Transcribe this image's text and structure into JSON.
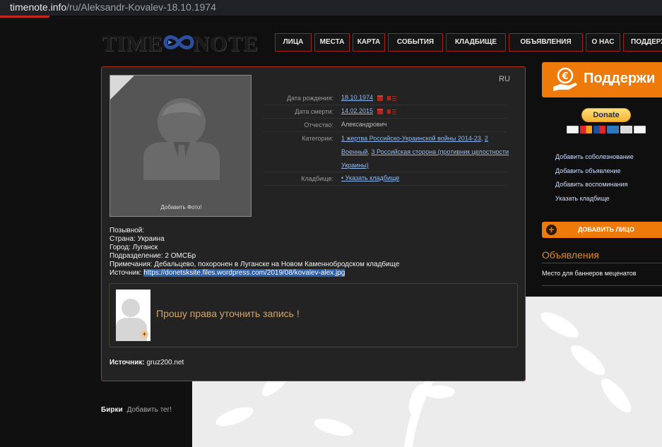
{
  "browser": {
    "url_host": "timenote.info",
    "url_path": "/ru/Aleksandr-Kovalev-18.10.1974"
  },
  "logo": {
    "left": "TIME",
    "right": "NOTE"
  },
  "nav": [
    "ЛИЦА",
    "МЕСТА",
    "КАРТА",
    "СОБЫТИЯ",
    "КЛАДБИЩЕ",
    "ОБЪЯВЛЕНИЯ",
    "О НАС",
    "ПОДДЕРЖКА"
  ],
  "profile": {
    "lang": "RU",
    "add_photo": "Добавить Фото!",
    "birth_label": "Дата рождения:",
    "birth_date": "18.10.1974",
    "death_label": "Дата смерти:",
    "death_date": "14.02.2015",
    "patronymic_label": "Отчество:",
    "patronymic": "Александрович",
    "categories_label": "Категории:",
    "categories": [
      "1 жертва Российско-Украинской войны 2014-23",
      "2 Военный",
      "3 Российская сторона (противник целостности Украины)"
    ],
    "cemetery_label": "Кладбище:",
    "cemetery_link": "• Указать кладбище"
  },
  "bio": {
    "callsign": "Позывной:",
    "country": "Страна: Украина",
    "city": "Город: Луганск",
    "unit": "Подразделение: 2 ОМСБр",
    "notes": "Примечания: Дебальцево, похоронен в Луганске на Новом Каменнобродском кладбище",
    "source_label": "Источник:",
    "source_url": "https://donetsksite.files.wordpress.com/2019/08/kovalev-alex.jpg"
  },
  "note_box": {
    "text": "Прошу права уточнить запись !",
    "plus": "+"
  },
  "source": {
    "label": "Источник:",
    "value": "gruz200.net"
  },
  "tags": {
    "label": "Бирки",
    "add": "Добавить тег!"
  },
  "sidebar": {
    "support": "Поддержи",
    "donate": "Donate",
    "links": [
      "Добавить соболезнование",
      "Добавить объявление",
      "Добавить воспоминания",
      "Указать кладбище"
    ],
    "add_face": "ДОБАВИТЬ ЛИЦО",
    "ads_title": "Объявления",
    "ads_text": "Место для баннеров меценатов"
  },
  "colors": {
    "accent": "#ee7a0a",
    "nav_border": "#a51d14",
    "card_border": "#b4321c",
    "link": "#8fb8ef"
  }
}
